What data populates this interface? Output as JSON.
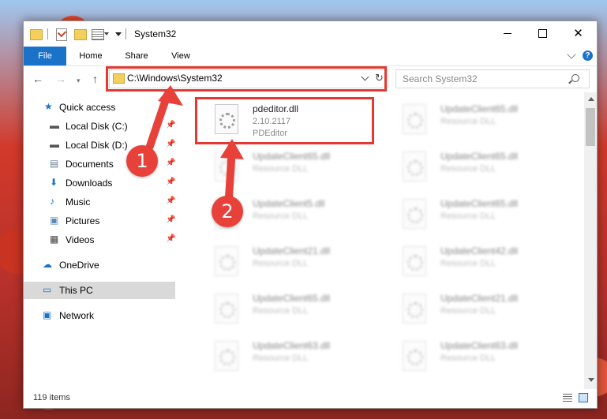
{
  "window": {
    "title": "System32",
    "minimize_glyph": "",
    "close_glyph": "✕"
  },
  "ribbon": {
    "tabs": [
      "File",
      "Home",
      "Share",
      "View"
    ],
    "help_glyph": "?"
  },
  "navigation": {
    "back_glyph": "←",
    "forward_glyph": "→",
    "recent_glyph": "▾",
    "up_glyph": "↑",
    "refresh_glyph": "↻",
    "address": "C:\\Windows\\System32",
    "search_placeholder": "Search System32"
  },
  "sidebar": {
    "items": [
      {
        "label": "Quick access",
        "icon": "star-icon",
        "glyph": "★",
        "color": "#1a73c9",
        "pinned": false
      },
      {
        "label": "Local Disk (C:)",
        "icon": "drive-icon",
        "glyph": "▬",
        "color": "#555555",
        "pinned": true
      },
      {
        "label": "Local Disk (D:)",
        "icon": "drive-icon",
        "glyph": "▬",
        "color": "#555555",
        "pinned": true
      },
      {
        "label": "Documents",
        "icon": "documents-icon",
        "glyph": "▤",
        "color": "#6a7f98",
        "pinned": true
      },
      {
        "label": "Downloads",
        "icon": "download-icon",
        "glyph": "⬇",
        "color": "#1a73c9",
        "pinned": true
      },
      {
        "label": "Music",
        "icon": "music-icon",
        "glyph": "♪",
        "color": "#1a73c9",
        "pinned": true
      },
      {
        "label": "Pictures",
        "icon": "pictures-icon",
        "glyph": "▣",
        "color": "#5a8ab8",
        "pinned": true
      },
      {
        "label": "Videos",
        "icon": "videos-icon",
        "glyph": "▦",
        "color": "#444444",
        "pinned": true
      },
      {
        "label": "OneDrive",
        "icon": "cloud-icon",
        "glyph": "☁",
        "color": "#1a73c9",
        "pinned": false
      },
      {
        "label": "This PC",
        "icon": "computer-icon",
        "glyph": "▭",
        "color": "#1a73c9",
        "pinned": false,
        "selected": true
      },
      {
        "label": "Network",
        "icon": "network-icon",
        "glyph": "▣",
        "color": "#1a73c9",
        "pinned": false
      }
    ],
    "pin_glyph": "📌"
  },
  "files": {
    "highlighted": {
      "name": "pdeditor.dll",
      "version": "2.10.2117",
      "description": "PDEditor"
    },
    "blurred": [
      {
        "name": "UpdateClient65.dll",
        "description": "Resource DLL"
      },
      {
        "name": "UpdateClient65.dll",
        "description": "Resource DLL"
      },
      {
        "name": "UpdateClient65.dll",
        "description": "Resource DLL"
      },
      {
        "name": "UpdateClient5.dll",
        "description": "Resource DLL"
      },
      {
        "name": "UpdateClient65.dll",
        "description": "Resource DLL"
      },
      {
        "name": "UpdateClient21.dll",
        "description": "Resource DLL"
      },
      {
        "name": "UpdateClient42.dll",
        "description": "Resource DLL"
      },
      {
        "name": "UpdateClient65.dll",
        "description": "Resource DLL"
      },
      {
        "name": "UpdateClient21.dll",
        "description": "Resource DLL"
      },
      {
        "name": "UpdateClient63.dll",
        "description": "Resource DLL"
      },
      {
        "name": "UpdateClient63.dll",
        "description": "Resource DLL"
      }
    ]
  },
  "status": {
    "item_count": "119 items"
  },
  "annotations": {
    "step1": "1",
    "step2": "2",
    "color": "#e23a32"
  }
}
